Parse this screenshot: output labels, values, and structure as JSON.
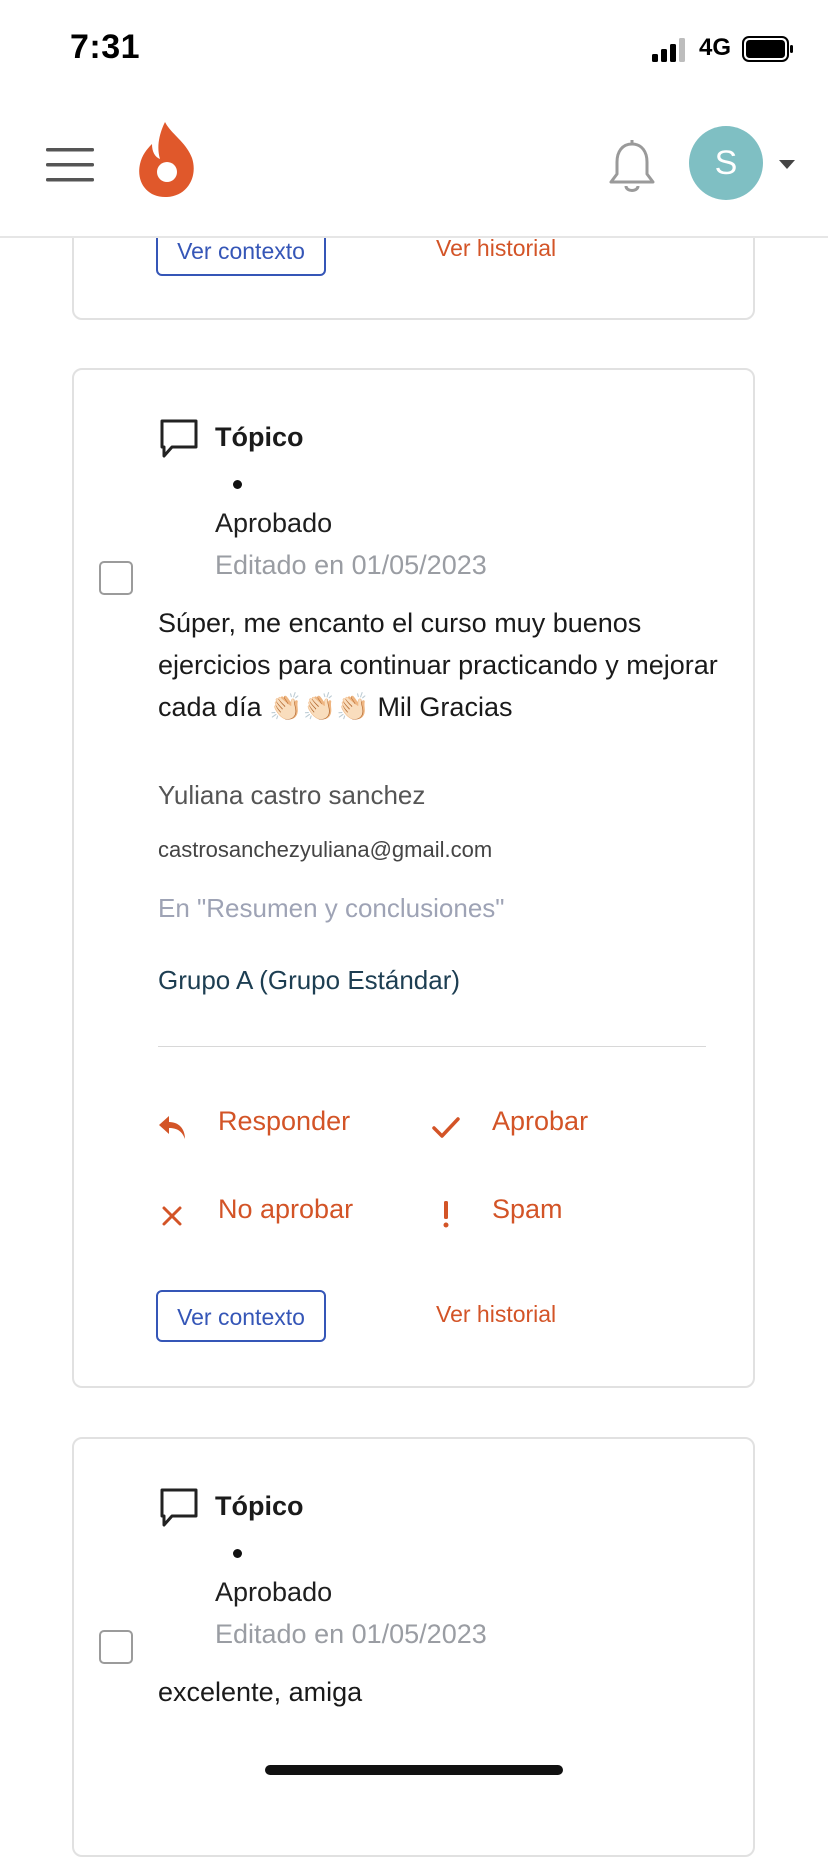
{
  "status_bar": {
    "time": "7:31",
    "network": "4G"
  },
  "header": {
    "avatar_initial": "S"
  },
  "top_card": {
    "context_button": "Ver contexto",
    "history_link": "Ver historial"
  },
  "main_card": {
    "type_label": "Tópico",
    "status": "Aprobado",
    "edited": "Editado en 01/05/2023",
    "body": "Súper, me encanto el curso muy buenos ejercicios para continuar practicando y mejorar cada día 👏🏻👏🏻👏🏻 Mil Gracias",
    "author": "Yuliana castro sanchez",
    "email": "castrosanchezyuliana@gmail.com",
    "context": "En \"Resumen y conclusiones\"",
    "group": "Grupo A (Grupo Estándar)",
    "actions": {
      "reply": "Responder",
      "approve": "Aprobar",
      "reject": "No aprobar",
      "spam": "Spam"
    },
    "context_button": "Ver contexto",
    "history_link": "Ver historial"
  },
  "bottom_card": {
    "type_label": "Tópico",
    "status": "Aprobado",
    "edited": "Editado en 01/05/2023",
    "body": "excelente, amiga"
  },
  "colors": {
    "accent": "#d35427",
    "link_blue": "#3556b7",
    "avatar_bg": "#7fbfc3",
    "muted": "#9a9da3"
  }
}
